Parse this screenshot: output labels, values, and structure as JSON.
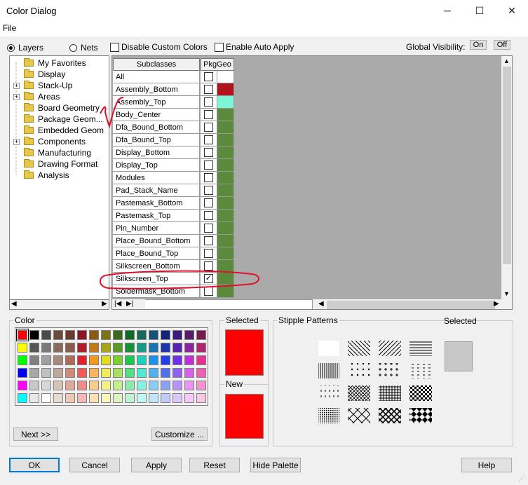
{
  "window": {
    "title": "Color Dialog",
    "minimize": "─",
    "maximize": "☐",
    "close": "✕"
  },
  "menu": {
    "file": "File"
  },
  "toolbar": {
    "layers": "Layers",
    "nets": "Nets",
    "disable_custom": "Disable Custom Colors",
    "enable_auto": "Enable Auto Apply",
    "global_visibility": "Global Visibility:",
    "on": "On",
    "off": "Off"
  },
  "tree": {
    "items": [
      "My Favorites",
      "Display",
      "Stack-Up",
      "Areas",
      "Board Geometry",
      "Package Geom...",
      "Embedded Geom",
      "Components",
      "Manufacturing",
      "Drawing Format",
      "Analysis"
    ]
  },
  "grid": {
    "header_subclasses": "Subclasses",
    "header_pkggeo": "PkgGeo",
    "rows": [
      {
        "name": "All",
        "checked": false,
        "color": "#ffffff"
      },
      {
        "name": "Assembly_Bottom",
        "checked": false,
        "color": "#b0141e"
      },
      {
        "name": "Assembly_Top",
        "checked": false,
        "color": "#7ef5d6"
      },
      {
        "name": "Body_Center",
        "checked": false,
        "color": "#5c8a3c"
      },
      {
        "name": "Dfa_Bound_Bottom",
        "checked": false,
        "color": "#5c8a3c"
      },
      {
        "name": "Dfa_Bound_Top",
        "checked": false,
        "color": "#5c8a3c"
      },
      {
        "name": "Display_Bottom",
        "checked": false,
        "color": "#5c8a3c"
      },
      {
        "name": "Display_Top",
        "checked": false,
        "color": "#5c8a3c"
      },
      {
        "name": "Modules",
        "checked": false,
        "color": "#5c8a3c"
      },
      {
        "name": "Pad_Stack_Name",
        "checked": false,
        "color": "#5c8a3c"
      },
      {
        "name": "Pastemask_Bottom",
        "checked": false,
        "color": "#5c8a3c"
      },
      {
        "name": "Pastemask_Top",
        "checked": false,
        "color": "#5c8a3c"
      },
      {
        "name": "Pin_Number",
        "checked": false,
        "color": "#5c8a3c"
      },
      {
        "name": "Place_Bound_Bottom",
        "checked": false,
        "color": "#5c8a3c"
      },
      {
        "name": "Place_Bound_Top",
        "checked": false,
        "color": "#5c8a3c"
      },
      {
        "name": "Silkscreen_Bottom",
        "checked": false,
        "color": "#5c8a3c"
      },
      {
        "name": "Silkscreen_Top",
        "checked": true,
        "color": "#5c8a3c"
      },
      {
        "name": "Soldermask_Bottom",
        "checked": false,
        "color": "#5c8a3c"
      }
    ]
  },
  "color_panel": {
    "legend": "Color",
    "next": "Next >>",
    "customize": "Customize ...",
    "palette": [
      [
        "#ff0000",
        "#000000",
        "#4a4a4a",
        "#6b4a3a",
        "#6a3a2e",
        "#8a1422",
        "#8a5a14",
        "#7a7414",
        "#3a6a1c",
        "#0c6a24",
        "#146a5a",
        "#14527a",
        "#14247a",
        "#3a1a7a",
        "#5a1a6a",
        "#7a1a4a"
      ],
      [
        "#ffff00",
        "#555555",
        "#7a7a7a",
        "#8c6a5a",
        "#8a5a4a",
        "#b01c2a",
        "#c07a1a",
        "#a8a418",
        "#5a9a28",
        "#14903a",
        "#1a9a86",
        "#1a74b0",
        "#1a34b0",
        "#5a24b0",
        "#8a24a0",
        "#b02470"
      ],
      [
        "#00ff00",
        "#808080",
        "#a0a0a0",
        "#a88a7a",
        "#b06a5a",
        "#e02030",
        "#f09a20",
        "#e0dc20",
        "#7cd030",
        "#1cc850",
        "#20d0b8",
        "#2090e8",
        "#2040e8",
        "#7030e8",
        "#c030d8",
        "#e83090"
      ],
      [
        "#0000ff",
        "#a8a8a8",
        "#c0c0c0",
        "#c0a898",
        "#d08a7a",
        "#f05a5a",
        "#f8b45a",
        "#f0ec5a",
        "#a8e060",
        "#50e080",
        "#50e8d0",
        "#50b0f0",
        "#5070f0",
        "#9060f0",
        "#d860e8",
        "#f060b0"
      ],
      [
        "#ff00ff",
        "#c8c8c8",
        "#d8d8d8",
        "#d8c4b4",
        "#e0a898",
        "#f08a8a",
        "#f8cc8a",
        "#f4f08a",
        "#c4ec90",
        "#8aeca8",
        "#8af0e0",
        "#8accf4",
        "#8aa0f4",
        "#b494f4",
        "#e894f0",
        "#f494cc"
      ],
      [
        "#00ffff",
        "#e8e8e8",
        "#ffffff",
        "#e8dcd0",
        "#f0c8b8",
        "#f8b8b8",
        "#fce0b8",
        "#f8f8b8",
        "#dcf4c0",
        "#c0f4d0",
        "#c0f8f0",
        "#c0e4f8",
        "#c0ccf8",
        "#d8c8f8",
        "#f4c8f8",
        "#f8c8e4"
      ]
    ]
  },
  "selected_panel": {
    "selected": "Selected",
    "selected_color": "#ff0000",
    "new": "New",
    "new_color": "#ff0000"
  },
  "stipple_panel": {
    "legend": "Stipple Patterns",
    "selected": "Selected",
    "selected_color": "#c8c8c8"
  },
  "buttons": {
    "ok": "OK",
    "cancel": "Cancel",
    "apply": "Apply",
    "reset": "Reset",
    "hide_palette": "Hide Palette",
    "help": "Help"
  },
  "colors": {
    "annotation_red": "#e0102a"
  }
}
